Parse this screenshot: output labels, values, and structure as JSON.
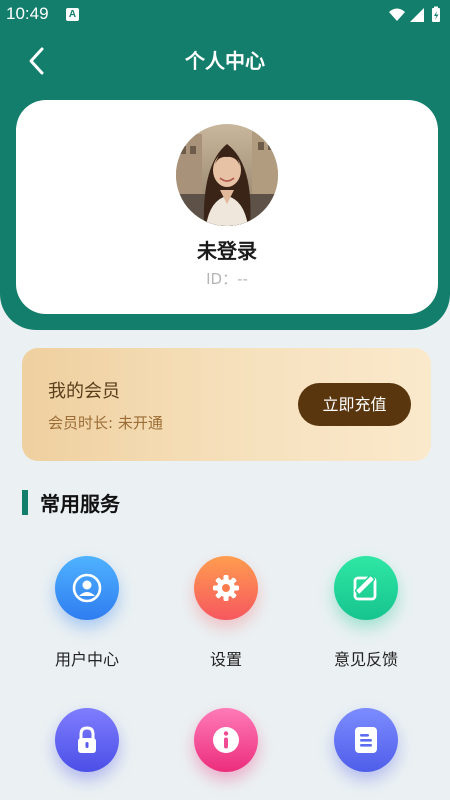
{
  "status_bar": {
    "time": "10:49",
    "notification_glyph": "A"
  },
  "header": {
    "title": "个人中心"
  },
  "profile": {
    "name": "未登录",
    "id_text": "ID：--"
  },
  "vip": {
    "title": "我的会员",
    "duration": "会员时长: 未开通",
    "button_label": "立即充值"
  },
  "section": {
    "title": "常用服务"
  },
  "services": [
    {
      "label": "用户中心",
      "icon": "user-icon",
      "color": "#3a95f5"
    },
    {
      "label": "设置",
      "icon": "gear-icon",
      "color": "#fb7d3c"
    },
    {
      "label": "意见反馈",
      "icon": "edit-icon",
      "color": "#1ed99a"
    },
    {
      "label": "",
      "icon": "lock-icon",
      "color": "#5458ee"
    },
    {
      "label": "",
      "icon": "info-icon",
      "color": "#f43f8d"
    },
    {
      "label": "",
      "icon": "document-icon",
      "color": "#5565ee"
    }
  ],
  "colors": {
    "primary": "#137e6b",
    "vip_button": "#5a360f",
    "background": "#ebf1f3"
  }
}
